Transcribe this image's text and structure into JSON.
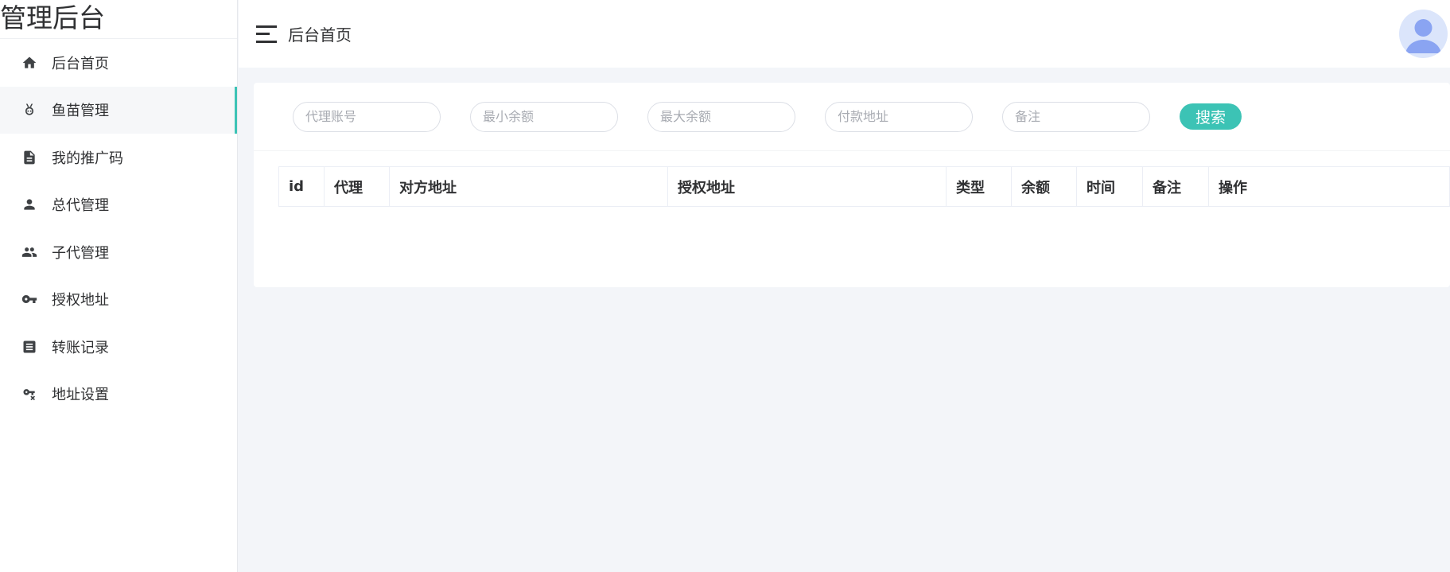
{
  "app": {
    "title": "管理后台"
  },
  "sidebar": {
    "items": [
      {
        "label": "后台首页",
        "icon": "home-icon"
      },
      {
        "label": "鱼苗管理",
        "icon": "fish-icon",
        "active": true
      },
      {
        "label": "我的推广码",
        "icon": "document-icon"
      },
      {
        "label": "总代管理",
        "icon": "person-icon"
      },
      {
        "label": "子代管理",
        "icon": "people-icon"
      },
      {
        "label": "授权地址",
        "icon": "key-icon"
      },
      {
        "label": "转账记录",
        "icon": "receipt-icon"
      },
      {
        "label": "地址设置",
        "icon": "key-off-icon"
      }
    ]
  },
  "header": {
    "page_title": "后台首页"
  },
  "filters": {
    "agent_account_placeholder": "代理账号",
    "min_balance_placeholder": "最小余额",
    "max_balance_placeholder": "最大余额",
    "payment_address_placeholder": "付款地址",
    "remark_placeholder": "备注",
    "search_label": "搜索"
  },
  "table": {
    "columns": [
      "id",
      "代理",
      "对方地址",
      "授权地址",
      "类型",
      "余额",
      "时间",
      "备注",
      "操作"
    ]
  },
  "colors": {
    "accent": "#3cc3b5",
    "background": "#f3f5f9",
    "avatar_bg": "#dbe5fb",
    "avatar_fg": "#8aa4f2"
  }
}
